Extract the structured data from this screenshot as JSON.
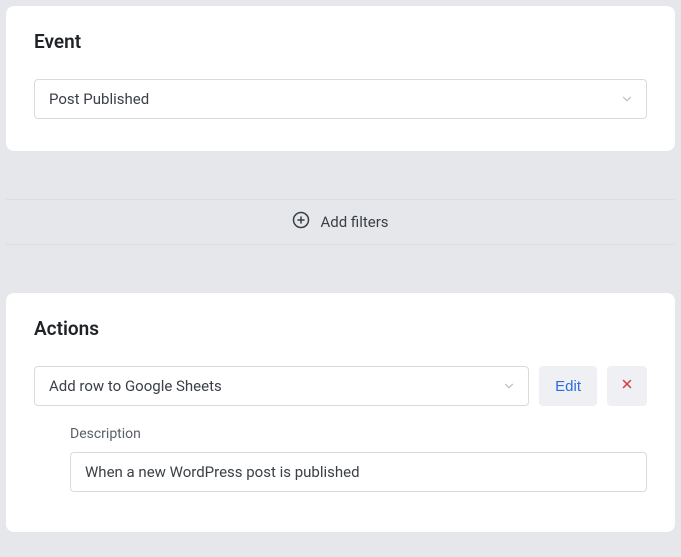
{
  "event": {
    "title": "Event",
    "selected": "Post Published"
  },
  "filters": {
    "add_label": "Add filters"
  },
  "actions": {
    "title": "Actions",
    "selected": "Add row to Google Sheets",
    "edit_label": "Edit",
    "fields": {
      "description": {
        "label": "Description",
        "value": "When a new WordPress post is published"
      }
    }
  }
}
